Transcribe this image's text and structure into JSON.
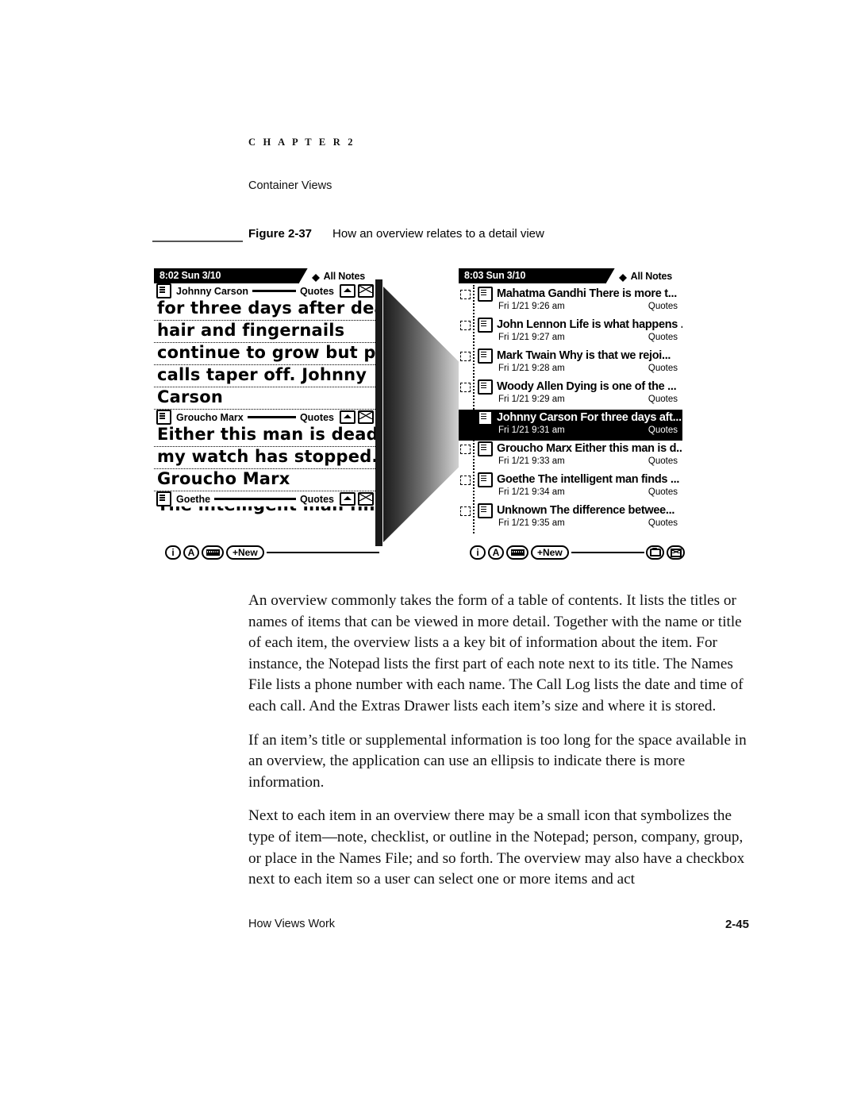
{
  "page": {
    "chapter_label": "C H A P T E R   2",
    "running_head": "Container Views",
    "footer_left": "How Views Work",
    "footer_page": "2-45"
  },
  "figure": {
    "number": "Figure 2-37",
    "title": "How an overview relates to a detail view",
    "detail_view": {
      "statusbar": {
        "clock": "8:02 Sun 3/10",
        "folder_tab": "All Notes"
      },
      "notes": [
        {
          "title": "Johnny Carson",
          "folder": "Quotes",
          "lines": [
            "for three days after death",
            "hair and fingernails",
            "continue to grow but phone",
            "calls taper off. Johnny",
            "Carson"
          ]
        },
        {
          "title": "Groucho Marx",
          "folder": "Quotes",
          "lines": [
            "Either this man is dead or",
            "my watch has stopped.",
            "Groucho Marx"
          ]
        },
        {
          "title": "Goethe",
          "folder": "Quotes",
          "lines": [
            "The intelligent man finds"
          ]
        }
      ],
      "buttons": {
        "info": "i",
        "font": "A",
        "keyboard": "keyboard-icon",
        "new": "+New"
      }
    },
    "overview_view": {
      "statusbar": {
        "clock": "8:03 Sun 3/10",
        "folder_tab": "All Notes"
      },
      "items": [
        {
          "title": "Mahatma Gandhi There is more t...",
          "date": "Fri 1/21 9:26 am",
          "folder": "Quotes",
          "selected": false
        },
        {
          "title": "John Lennon Life is what happens ...",
          "date": "Fri 1/21 9:27 am",
          "folder": "Quotes",
          "selected": false
        },
        {
          "title": "Mark Twain Why is that we rejoi...",
          "date": "Fri 1/21 9:28 am",
          "folder": "Quotes",
          "selected": false
        },
        {
          "title": "Woody Allen Dying is one of the ...",
          "date": "Fri 1/21 9:29 am",
          "folder": "Quotes",
          "selected": false
        },
        {
          "title": "Johnny Carson For three days aft...",
          "date": "Fri 1/21 9:31 am",
          "folder": "Quotes",
          "selected": true
        },
        {
          "title": "Groucho Marx Either this man is d...",
          "date": "Fri 1/21 9:33 am",
          "folder": "Quotes",
          "selected": false
        },
        {
          "title": "Goethe The intelligent man finds ...",
          "date": "Fri 1/21 9:34 am",
          "folder": "Quotes",
          "selected": false
        },
        {
          "title": "Unknown The difference betwee...",
          "date": "Fri 1/21 9:35 am",
          "folder": "Quotes",
          "selected": false
        }
      ],
      "buttons": {
        "info": "i",
        "font": "A",
        "keyboard": "keyboard-icon",
        "new": "+New",
        "filing": "folder-icon",
        "mail": "envelope-icon"
      }
    }
  },
  "body": {
    "paragraphs": [
      "An overview commonly takes the form of a table of contents. It lists the titles or names of items that can be viewed in more detail. Together with the name or title of each item, the overview lists a a key bit of information about the item. For instance, the Notepad lists the first part of each note next to its title. The Names File lists a phone number with each name. The Call Log lists the date and time of each call. And the Extras Drawer lists each item’s size and where it is stored.",
      "If an item’s title or supplemental information is too long for the space available in an overview, the application can use an ellipsis to indicate there is more information.",
      "Next to each item in an overview there may be a small icon that symbolizes the type of item—note, checklist, or outline in the Notepad; person, company, group, or place in the Names File; and so forth. The overview may also have a checkbox next to each item so a user can select one or more items and act"
    ]
  },
  "colors": {
    "ink": "#000000",
    "paper": "#ffffff",
    "rule": "#555555"
  }
}
